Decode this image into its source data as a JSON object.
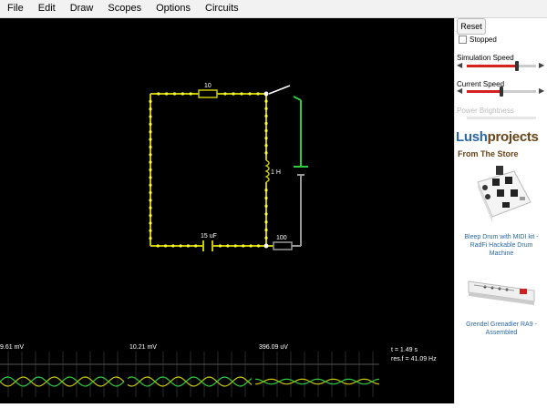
{
  "menubar": {
    "items": [
      "File",
      "Edit",
      "Draw",
      "Scopes",
      "Options",
      "Circuits"
    ]
  },
  "circuit": {
    "resistor1_label": "10",
    "inductor_label": "1 H",
    "capacitor_label": "15 uF",
    "resistor2_label": "100"
  },
  "scopes": {
    "readouts": [
      "9.61 mV",
      "10.21 mV",
      "396.09 uV"
    ],
    "time": "t = 1.49 s",
    "resonance": "res.f = 41.09 Hz"
  },
  "sidebar": {
    "reset_label": "Reset",
    "stopped_label": "Stopped",
    "stopped_checked": false,
    "simulation_speed_label": "Simulation Speed",
    "simulation_speed_value": 0.72,
    "current_speed_label": "Current Speed",
    "current_speed_value": 0.5,
    "power_brightness_label": "Power Brightness",
    "brand_part1": "Lush",
    "brand_part2": "projects",
    "store_label": "From The Store",
    "product1_title": "Bleep Drum with MIDI kit - RadFi Hackable Drum Machine",
    "product2_title": "Grendel Grenadier RA9 - Assembled"
  },
  "colors": {
    "wire_yellow": "#c8c800",
    "wire_gray": "#999999",
    "wire_green": "#2ecc40",
    "scope_green": "#2ecc40",
    "scope_yellow": "#c8c800",
    "slider_red": "#d42020",
    "brand_blue": "#2a68a8",
    "brand_brown": "#6a4419"
  }
}
